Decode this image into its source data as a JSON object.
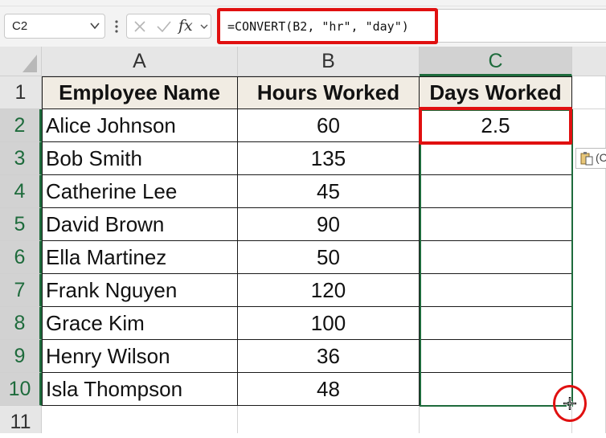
{
  "name_box": {
    "value": "C2"
  },
  "formula_bar": {
    "formula": "=CONVERT(B2, \"hr\", \"day\")",
    "fx_label": "fx"
  },
  "columns": [
    "A",
    "B",
    "C"
  ],
  "rows": [
    "1",
    "2",
    "3",
    "4",
    "5",
    "6",
    "7",
    "8",
    "9",
    "10",
    "11"
  ],
  "table": {
    "headers": [
      "Employee Name",
      "Hours Worked",
      "Days Worked"
    ],
    "data": [
      {
        "name": "Alice Johnson",
        "hours": "60",
        "days": "2.5"
      },
      {
        "name": "Bob Smith",
        "hours": "135",
        "days": ""
      },
      {
        "name": "Catherine Lee",
        "hours": "45",
        "days": ""
      },
      {
        "name": "David Brown",
        "hours": "90",
        "days": ""
      },
      {
        "name": "Ella Martinez",
        "hours": "50",
        "days": ""
      },
      {
        "name": "Frank Nguyen",
        "hours": "120",
        "days": ""
      },
      {
        "name": "Grace Kim",
        "hours": "100",
        "days": ""
      },
      {
        "name": "Henry Wilson",
        "hours": "36",
        "days": ""
      },
      {
        "name": "Isla Thompson",
        "hours": "48",
        "days": ""
      }
    ]
  },
  "paste_options": {
    "label": "(C"
  },
  "colors": {
    "selection": "#1e6b3c",
    "highlight": "#e01010",
    "header_fill": "#f1ece3"
  },
  "icons": [
    "chevron-down-icon",
    "more-options-icon",
    "cancel-icon",
    "enter-icon",
    "fx-icon",
    "select-all-icon",
    "paste-options-icon",
    "fill-cursor-icon"
  ]
}
